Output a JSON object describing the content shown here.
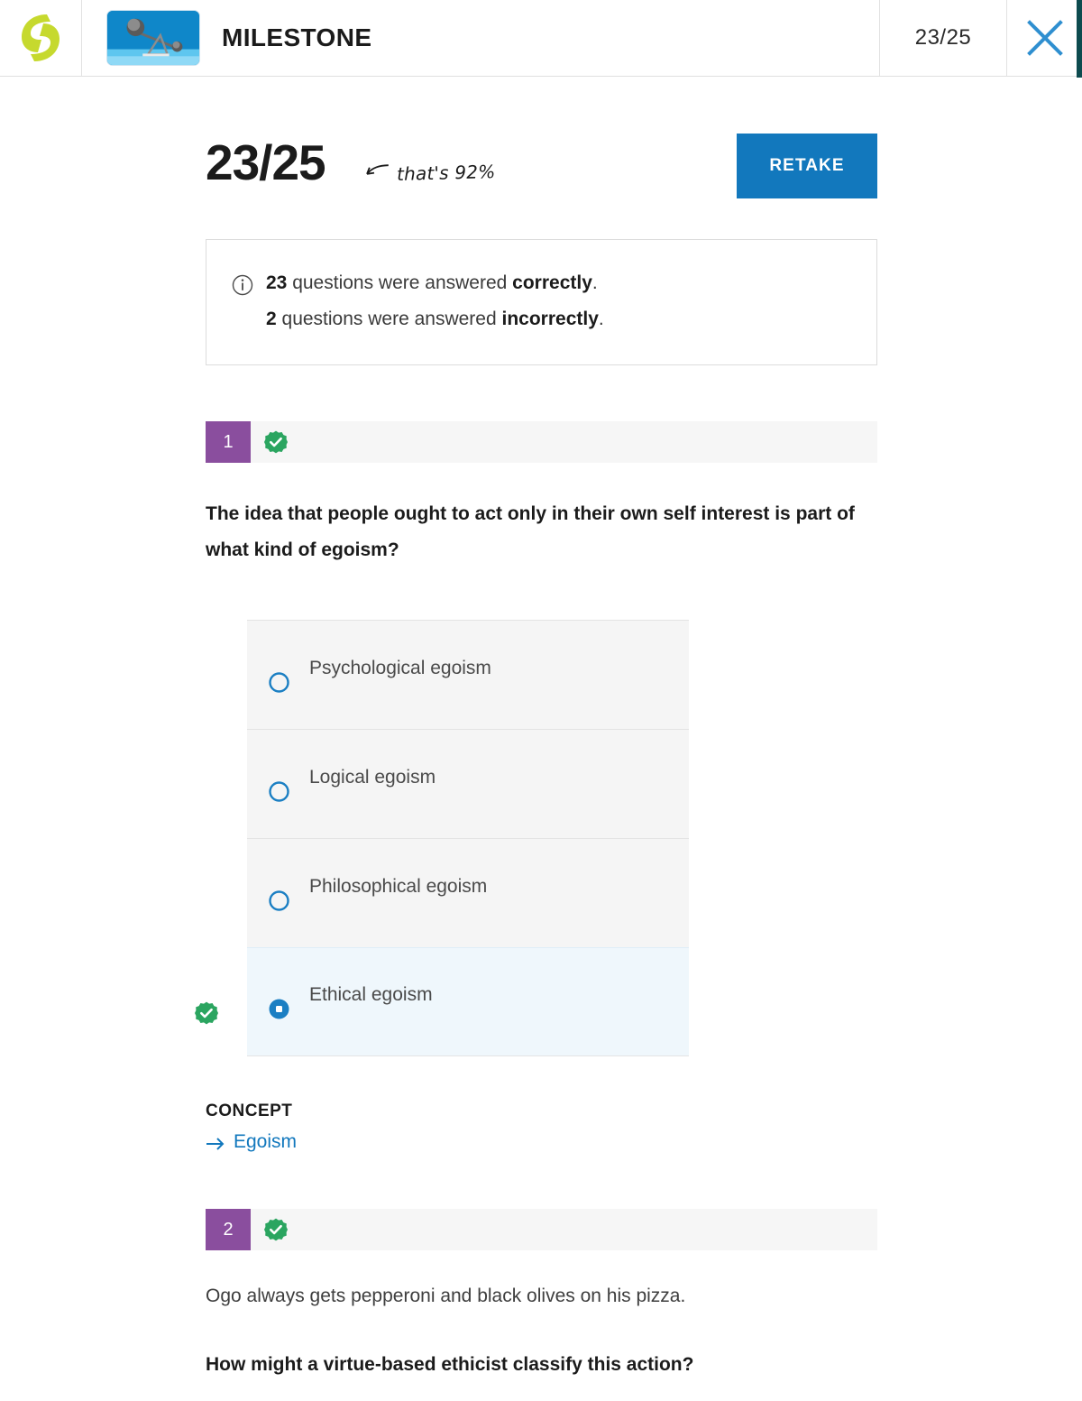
{
  "header": {
    "logo_name": "sophia-logo",
    "thumbnail_name": "seesaw-balance-thumbnail",
    "title": "MILESTONE",
    "score": "23/25",
    "close_label": "×"
  },
  "summary": {
    "big_score": "23/25",
    "hand_note": "that's 92%",
    "retake_label": "RETAKE",
    "info": {
      "correct_count": "23",
      "correct_text_mid": " questions were answered ",
      "correct_word": "correctly",
      "correct_end": ".",
      "incorrect_count": "2",
      "incorrect_text_mid": " questions were answered ",
      "incorrect_word": "incorrectly",
      "incorrect_end": "."
    }
  },
  "questions": [
    {
      "number": "1",
      "status": "correct",
      "text": "The idea that people ought to act only in their own self interest is part of what kind of egoism?",
      "context": "",
      "options": [
        {
          "label": "Psychological egoism",
          "selected": false,
          "correct": false
        },
        {
          "label": "Logical egoism",
          "selected": false,
          "correct": false
        },
        {
          "label": "Philosophical egoism",
          "selected": false,
          "correct": false
        },
        {
          "label": "Ethical egoism",
          "selected": true,
          "correct": true
        }
      ],
      "concept_title": "CONCEPT",
      "concept_link": "Egoism"
    },
    {
      "number": "2",
      "status": "correct",
      "context": "Ogo always gets pepperoni and black olives on his pizza.",
      "text": "How might a virtue-based ethicist classify this action?"
    }
  ],
  "colors": {
    "accent_blue": "#1278bd",
    "purple_badge": "#8a4e9e",
    "green_check": "#2ba560",
    "logo_green": "#c6d92e",
    "rail_teal": "#0d4b4f",
    "selected_bg": "#eff7fc",
    "option_bg": "#f5f5f5"
  }
}
